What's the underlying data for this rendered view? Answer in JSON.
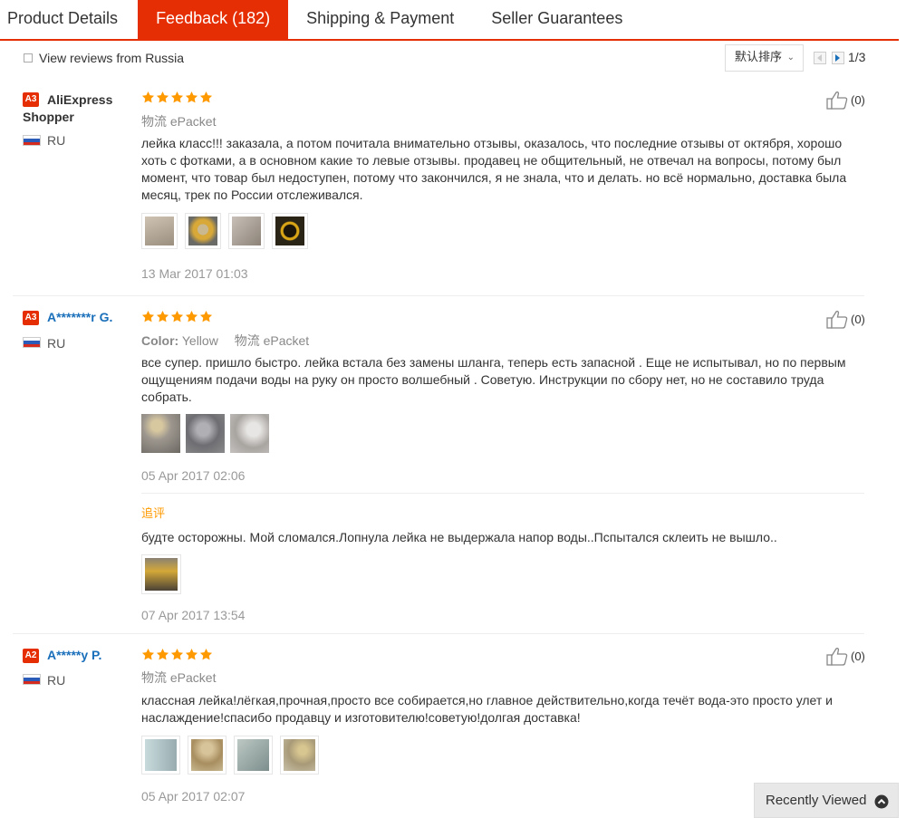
{
  "tabs": [
    {
      "label": "Product Details"
    },
    {
      "label": "Feedback (182)"
    },
    {
      "label": "Shipping & Payment"
    },
    {
      "label": "Seller Guarantees"
    }
  ],
  "filter": {
    "view_russia_label": "View reviews from Russia",
    "view_russia_checked": false
  },
  "sort": {
    "label": "默认排序"
  },
  "pager": {
    "text": "1/3"
  },
  "reviews": [
    {
      "badge": "A3",
      "name": "AliExpress Shopper",
      "country": "RU",
      "rating": 5,
      "logistics": "物流 ePacket",
      "text": "лейка класс!!! заказала, а потом почитала внимательно отзывы, оказалось, что последние отзывы от октября, хорошо хоть с фотками, а в основном какие то левые отзывы. продавец не общительный, не отвечал на вопросы, потому был момент, что товар был недоступен, потому что закончился, я не знала, что и делать. но всё нормально, доставка была месяц, трек по России отслеживался.",
      "photos": [
        "#b8aa98",
        "#d8a838",
        "#a8a09a",
        "#2a2416"
      ],
      "date": "13 Mar 2017 01:03",
      "helpful": "(0)"
    },
    {
      "badge": "A3",
      "name": "A*******r G.",
      "country": "RU",
      "rating": 5,
      "color_label": "Color:",
      "color_value": "Yellow",
      "logistics": "物流 ePacket",
      "text": "все супер. пришло быстро. лейка встала без замены шланга, теперь есть запасной . Еще не испытывал, но по первым ощущениям подачи воды на руку он просто волшебный . Советую. Инструкции по сбору нет, но не составило труда собрать.",
      "photos": [
        "#9c968e",
        "#8a8a8c",
        "#c6c2c0"
      ],
      "date": "05 Apr 2017 02:06",
      "additional": {
        "label": "追评",
        "text": "будте осторожны. Мой сломался.Лопнула лейка не выдержала напор воды..Пспытался склеить не вышло..",
        "photos": [
          "#6a6250"
        ],
        "date": "07 Apr 2017 13:54"
      },
      "helpful": "(0)"
    },
    {
      "badge": "A2",
      "name": "A*****y P.",
      "country": "RU",
      "rating": 5,
      "logistics": "物流 ePacket",
      "text": "классная лейка!лёгкая,прочная,просто все собирается,но главное действительно,когда течёт вода-это просто улет и наслаждение!спасибо продавцу и изготовителю!советую!долгая доставка!",
      "photos": [
        "#b0c4c8",
        "#b8a27a",
        "#98aaa8",
        "#a89a78"
      ],
      "date": "05 Apr 2017 02:07",
      "helpful": "(0)"
    }
  ],
  "recently_viewed": {
    "label": "Recently Viewed"
  },
  "colors": {
    "accent": "#e62e04",
    "star": "#f90",
    "link": "#1a6fba"
  }
}
